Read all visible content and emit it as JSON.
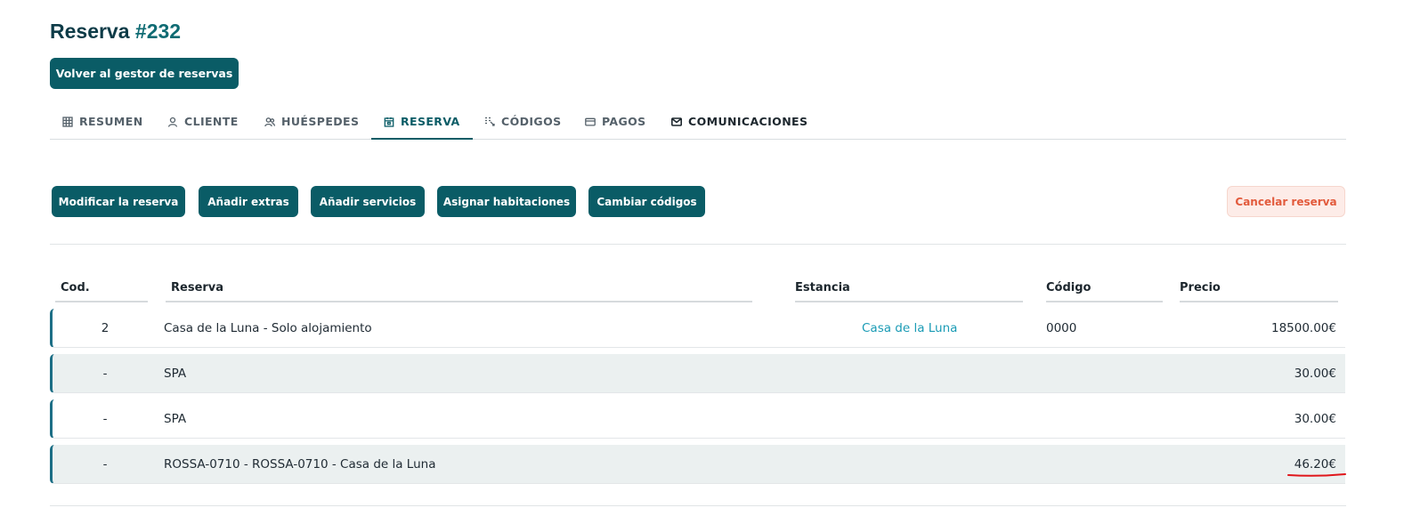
{
  "header": {
    "title_prefix": "Reserva ",
    "title_number": "#232"
  },
  "back_button": {
    "label": "Volver al gestor de reservas"
  },
  "tabs": [
    {
      "label": "RESUMEN",
      "icon": "grid-icon"
    },
    {
      "label": "CLIENTE",
      "icon": "user-icon"
    },
    {
      "label": "HUÉSPEDES",
      "icon": "users-icon"
    },
    {
      "label": "RESERVA",
      "icon": "calendar-icon"
    },
    {
      "label": "CÓDIGOS",
      "icon": "codes-icon"
    },
    {
      "label": "PAGOS",
      "icon": "card-icon"
    },
    {
      "label": "COMUNICACIONES",
      "icon": "mail-icon"
    }
  ],
  "active_tab": "RESERVA",
  "actions": {
    "modify": "Modificar la reserva",
    "extras": "Añadir extras",
    "services": "Añadir servicios",
    "rooms": "Asignar habitaciones",
    "codes": "Cambiar códigos",
    "cancel": "Cancelar reserva"
  },
  "table": {
    "headers": {
      "cod": "Cod.",
      "reserva": "Reserva",
      "estancia": "Estancia",
      "codigo": "Código",
      "precio": "Precio"
    },
    "rows": [
      {
        "cod": "2",
        "reserva": "Casa de la Luna - Solo alojamiento",
        "estancia": "Casa de la Luna",
        "codigo": "0000",
        "precio": "18500.00€"
      },
      {
        "cod": "-",
        "reserva": "SPA",
        "estancia": "",
        "codigo": "",
        "precio": "30.00€"
      },
      {
        "cod": "-",
        "reserva": "SPA",
        "estancia": "",
        "codigo": "",
        "precio": "30.00€"
      },
      {
        "cod": "-",
        "reserva": "ROSSA-0710 - ROSSA-0710 - Casa de la Luna",
        "estancia": "",
        "codigo": "",
        "precio": "46.20€"
      }
    ]
  },
  "colors": {
    "primary": "#0a5c66",
    "accent_link": "#1a9bb5",
    "cancel_text": "#e25a3c",
    "cancel_bg": "#fdece8",
    "highlight_mark": "#e0161b"
  }
}
